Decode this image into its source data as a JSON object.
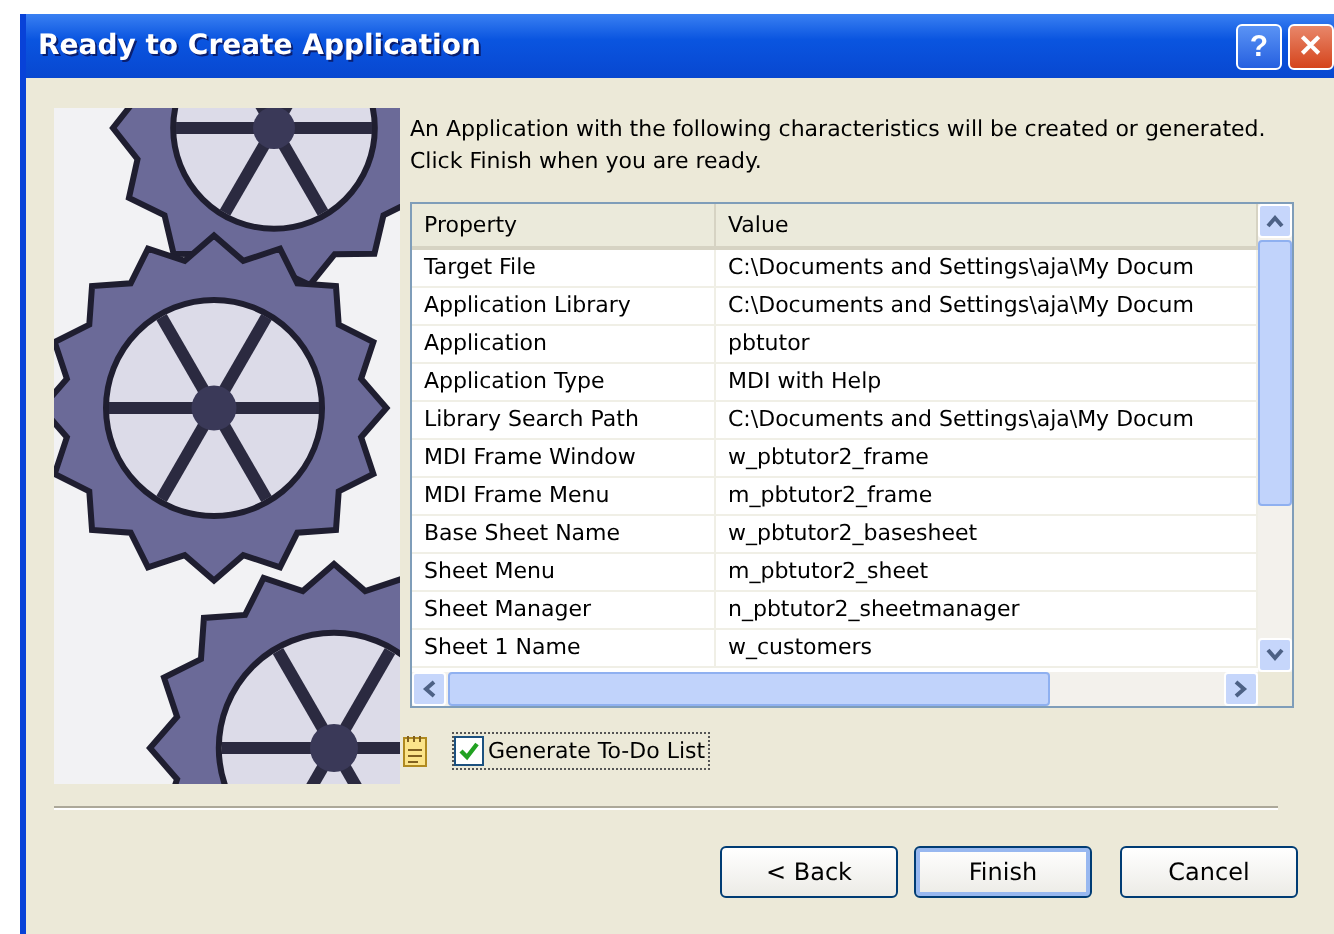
{
  "window": {
    "title": "Ready to Create Application",
    "title_buttons": [
      "?",
      "✕"
    ]
  },
  "intro": "An Application with the following characteristics will be created or generated.  Click Finish when you are ready.",
  "table": {
    "columns": [
      "Property",
      "Value"
    ],
    "rows": [
      [
        "Target File",
        "C:\\Documents and Settings\\aja\\My Docum"
      ],
      [
        "Application Library",
        "C:\\Documents and Settings\\aja\\My Docum"
      ],
      [
        "Application",
        "pbtutor"
      ],
      [
        "Application Type",
        "MDI with Help"
      ],
      [
        "Library Search Path",
        "C:\\Documents and Settings\\aja\\My Docum"
      ],
      [
        "MDI Frame Window",
        "w_pbtutor2_frame"
      ],
      [
        "MDI Frame Menu",
        "m_pbtutor2_frame"
      ],
      [
        "Base Sheet Name",
        "w_pbtutor2_basesheet"
      ],
      [
        "Sheet Menu",
        "m_pbtutor2_sheet"
      ],
      [
        "Sheet Manager",
        "n_pbtutor2_sheetmanager"
      ],
      [
        "Sheet 1 Name",
        "w_customers"
      ]
    ]
  },
  "todo": {
    "label": "Generate To-Do List",
    "checked": true
  },
  "buttons": [
    {
      "label": "< Back",
      "default": false
    },
    {
      "label": "Finish",
      "default": true
    },
    {
      "label": "Cancel",
      "default": false
    }
  ]
}
